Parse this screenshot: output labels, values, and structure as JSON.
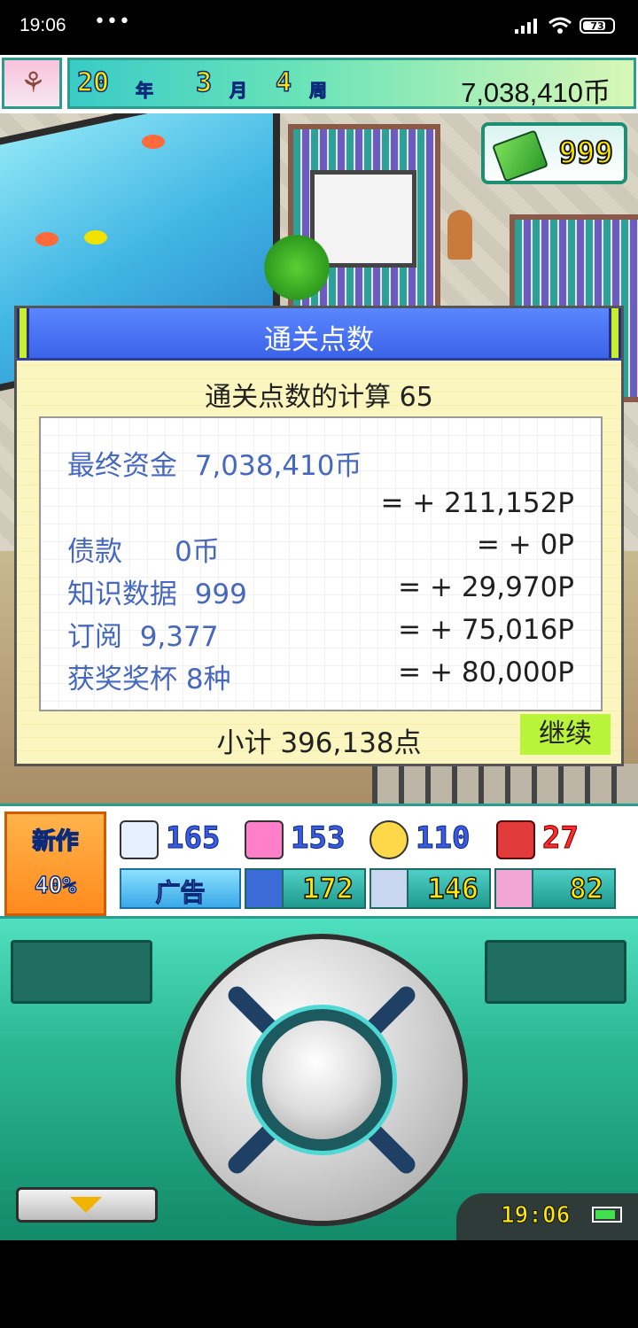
{
  "status_bar": {
    "time": "19:06",
    "dots": "•••",
    "battery": "73"
  },
  "hud": {
    "year_num": "20",
    "year_unit": "年",
    "month_num": "3",
    "month_unit": "月",
    "week_num": "4",
    "week_unit": "周",
    "money": "7,038,410币",
    "knowledge": "999"
  },
  "dialog": {
    "title": "通关点数",
    "subtitle": "通关点数的计算 65",
    "rows": [
      {
        "label": "最终资金  7,038,410币",
        "value": ""
      },
      {
        "label": "",
        "value": "= + 211,152P"
      },
      {
        "label": "债款      0币",
        "value": "= + 0P"
      },
      {
        "label": "知识数据  999",
        "value": "= + 29,970P"
      },
      {
        "label": "订阅  9,377",
        "value": "= + 75,016P"
      },
      {
        "label": "获奖奖杯 8种",
        "value": "= + 80,000P"
      }
    ],
    "subtotal": "小计 396,138点",
    "continue_label": "继续"
  },
  "stats": {
    "new_label": "新作",
    "new_percent": "40%",
    "s1": "165",
    "s2": "153",
    "s3": "110",
    "s4": "27",
    "ad_label": "广告",
    "b1": "172",
    "b2": "146",
    "b3": "82"
  },
  "controller": {
    "clock": "19:06"
  },
  "colors": {
    "dialog_header": "#3b63e8",
    "dialog_bg": "#fbf6bf",
    "continue_bg": "#b9f43a",
    "controller": "#2bb792"
  }
}
